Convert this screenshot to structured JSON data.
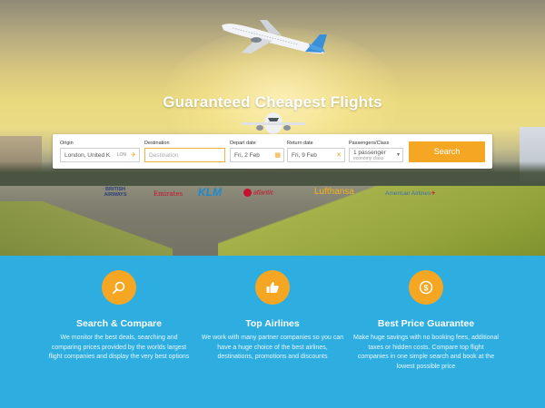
{
  "hero": {
    "title": "Guaranteed Cheapest Flights"
  },
  "search_form": {
    "origin": {
      "label": "Origin",
      "value": "London, United K",
      "suffix": "LON"
    },
    "destination": {
      "label": "Destination",
      "placeholder": "Destination"
    },
    "depart": {
      "label": "Depart date",
      "value": "Fri, 2 Feb"
    },
    "return": {
      "label": "Return date",
      "value": "Fri, 9 Feb"
    },
    "passengers": {
      "label": "Passengers/Class",
      "value": "1 passenger",
      "class": "economy class"
    },
    "search_label": "Search"
  },
  "airlines": {
    "british": "BRITISH AIRWAYS",
    "emirates": "Emirates",
    "klm": "KLM",
    "virgin": "atlantic",
    "lufthansa": "Lufthansa",
    "american": "American Airlines"
  },
  "features": [
    {
      "icon": "search-icon",
      "title": "Search & Compare",
      "text": "We monitor the best deals, searching and comparing prices provided by the worlds largest flight companies and display the very best options"
    },
    {
      "icon": "thumbs-up-icon",
      "title": "Top Airlines",
      "text": "We work with many partner companies so you can have a huge choice of the best airlines, destinations, promotions and discounts"
    },
    {
      "icon": "dollar-icon",
      "title": "Best Price Guarantee",
      "text": "Make huge savings with no booking fees, additional taxes or hidden costs. Compare top flight companies in one simple search and book at the lowest possible price"
    }
  ],
  "colors": {
    "accent": "#f5a623",
    "features_bg": "#2eaee0"
  }
}
